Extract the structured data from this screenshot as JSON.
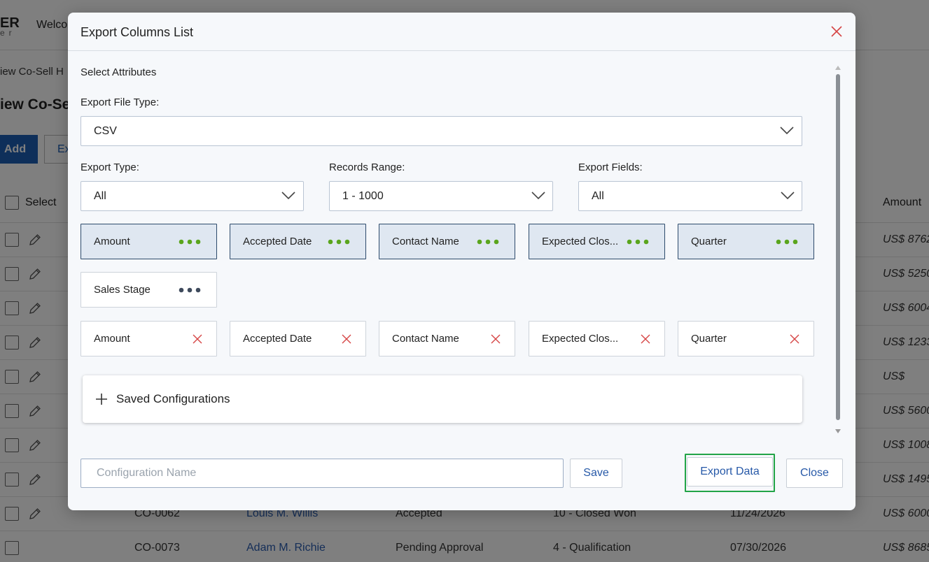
{
  "background": {
    "logo": "ER",
    "logo_sub": "er",
    "welcome": "Welco",
    "breadcrumb": "iew Co-Sell H",
    "page_title": "iew Co-Se",
    "add_button": "Add",
    "export_button_partial": "Ex",
    "table": {
      "col_select": "Select",
      "col_amount": "Amount",
      "amounts": [
        "US$ 8762",
        "US$ 5250",
        "US$ 6004",
        "US$ 1233",
        "US$",
        "US$ 5600",
        "US$ 1008",
        "US$ 1495",
        "US$ 6000",
        "US$ 8685"
      ],
      "rows_visible": [
        {
          "id": "CO-0062",
          "contact": "Louis M. Willis",
          "status": "Accepted",
          "stage": "10 - Closed Won",
          "date": "11/24/2026"
        },
        {
          "id": "CO-0073",
          "contact": "Adam M. Richie",
          "status": "Pending Approval",
          "stage": "4 - Qualification",
          "date": "07/30/2026"
        }
      ]
    }
  },
  "modal": {
    "title": "Export Columns List",
    "section_label": "Select Attributes",
    "file_type": {
      "label": "Export File Type:",
      "value": "CSV"
    },
    "export_type": {
      "label": "Export Type:",
      "value": "All"
    },
    "records_range": {
      "label": "Records Range:",
      "value": "1 - 1000"
    },
    "export_fields": {
      "label": "Export Fields:",
      "value": "All"
    },
    "available_columns": [
      {
        "label": "Amount",
        "active": true
      },
      {
        "label": "Accepted Date",
        "active": true
      },
      {
        "label": "Contact Name",
        "active": true
      },
      {
        "label": "Expected Clos...",
        "active": true
      },
      {
        "label": "Quarter",
        "active": true
      },
      {
        "label": "Sales Stage",
        "active": false
      }
    ],
    "selected_columns": [
      {
        "label": "Amount"
      },
      {
        "label": "Accepted Date"
      },
      {
        "label": "Contact Name"
      },
      {
        "label": "Expected Clos..."
      },
      {
        "label": "Quarter"
      }
    ],
    "saved_configurations_label": "Saved Configurations",
    "config_name_placeholder": "Configuration Name",
    "config_name_value": "",
    "save_label": "Save",
    "export_label": "Export Data",
    "close_label": "Close"
  },
  "colors": {
    "accent_blue": "#2759a8",
    "dots_active": "#5aa51d",
    "dots_inactive": "#3e4a5c",
    "remove_x": "#d64545",
    "focus_green": "#22a447",
    "chip_active_bg": "#dfe7f1"
  },
  "icons": {
    "close": "close-icon",
    "chevron": "chevron-down-icon",
    "more": "more-dots-icon",
    "remove": "remove-x-icon",
    "plus": "plus-icon",
    "edit": "pencil-icon",
    "checkbox": "checkbox-icon"
  }
}
